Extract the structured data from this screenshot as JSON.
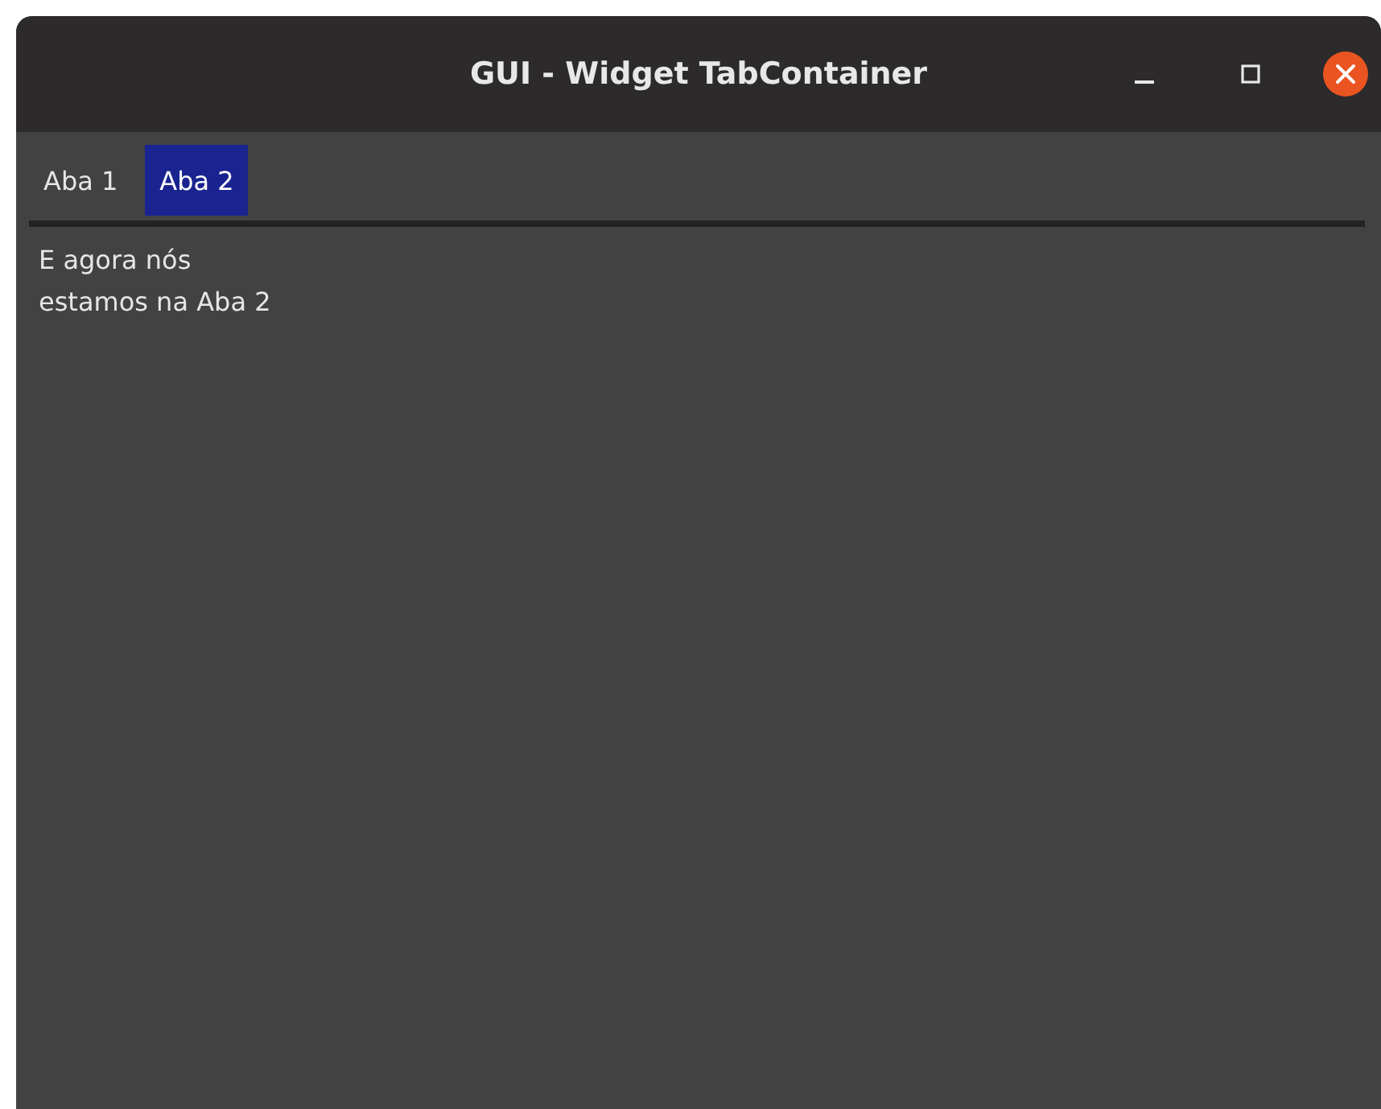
{
  "window": {
    "title": "GUI - Widget TabContainer"
  },
  "tabs": [
    {
      "label": "Aba 1",
      "selected": false
    },
    {
      "label": "Aba 2",
      "selected": true
    }
  ],
  "content": {
    "text": "E agora nós\nestamos na Aba 2"
  }
}
